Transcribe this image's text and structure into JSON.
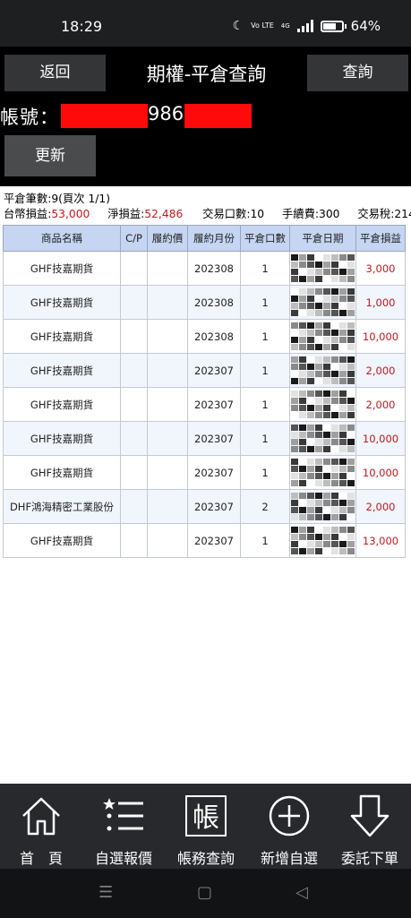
{
  "status_bar": {
    "time": "18:29",
    "network": "4G",
    "volte": "Vo LTE",
    "battery": "64%"
  },
  "header": {
    "back_label": "返回",
    "title": "期權-平倉查詢",
    "query_label": "查詢",
    "account_label": "帳號：",
    "account_visible_part": "986",
    "refresh_label": "更新"
  },
  "summary": {
    "count_text": "平倉筆數:9(頁次 1/1)",
    "twd_pl_label": "台幣損益:",
    "twd_pl_value": "53,000",
    "net_pl_label": "淨損益:",
    "net_pl_value": "52,486",
    "trade_qty_text": "交易口數:10",
    "fee_text": "手續費:300",
    "tax_text": "交易稅:214"
  },
  "table": {
    "headers": [
      "商品名稱",
      "C/P",
      "履約價",
      "履約月份",
      "平倉口數",
      "平倉日期",
      "平倉損益"
    ],
    "rows": [
      {
        "product": "GHF技嘉期貨",
        "cp": "",
        "strike": "",
        "month": "202308",
        "qty": "1",
        "pl": "3,000"
      },
      {
        "product": "GHF技嘉期貨",
        "cp": "",
        "strike": "",
        "month": "202308",
        "qty": "1",
        "pl": "1,000"
      },
      {
        "product": "GHF技嘉期貨",
        "cp": "",
        "strike": "",
        "month": "202308",
        "qty": "1",
        "pl": "10,000"
      },
      {
        "product": "GHF技嘉期貨",
        "cp": "",
        "strike": "",
        "month": "202307",
        "qty": "1",
        "pl": "2,000"
      },
      {
        "product": "GHF技嘉期貨",
        "cp": "",
        "strike": "",
        "month": "202307",
        "qty": "1",
        "pl": "2,000"
      },
      {
        "product": "GHF技嘉期貨",
        "cp": "",
        "strike": "",
        "month": "202307",
        "qty": "1",
        "pl": "10,000"
      },
      {
        "product": "GHF技嘉期貨",
        "cp": "",
        "strike": "",
        "month": "202307",
        "qty": "1",
        "pl": "10,000"
      },
      {
        "product": "DHF鴻海精密工業股份",
        "cp": "",
        "strike": "",
        "month": "202307",
        "qty": "2",
        "pl": "2,000"
      },
      {
        "product": "GHF技嘉期貨",
        "cp": "",
        "strike": "",
        "month": "202307",
        "qty": "1",
        "pl": "13,000"
      }
    ]
  },
  "bottom_nav": {
    "items": [
      {
        "label": "首　頁",
        "icon": "home-icon"
      },
      {
        "label": "自選報價",
        "icon": "list-icon"
      },
      {
        "label": "帳務查詢",
        "icon": "ledger-icon"
      },
      {
        "label": "新增自選",
        "icon": "add-circle-icon"
      },
      {
        "label": "委託下單",
        "icon": "down-arrow-icon"
      }
    ],
    "ledger_glyph": "帳"
  },
  "colors": {
    "header_bg": "#000000",
    "button_bg": "#333537",
    "table_header_bg": "#c5d5f2",
    "profit_red": "#c8161d",
    "redaction": "#ff0a0a",
    "nav_bg": "#27292d"
  }
}
